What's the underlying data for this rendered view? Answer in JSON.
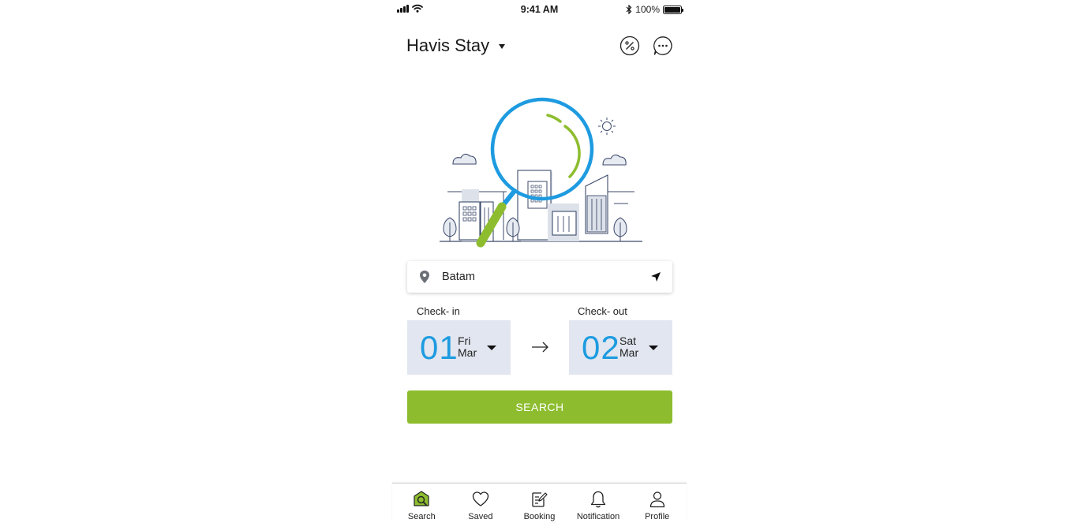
{
  "status_bar": {
    "time": "9:41 AM",
    "battery": "100%"
  },
  "header": {
    "title": "Havis Stay",
    "promo_icon": "percent-icon",
    "chat_icon": "chat-icon"
  },
  "location": {
    "value": "Batam",
    "pin_icon": "location-pin-icon",
    "locate_icon": "navigation-arrow-icon"
  },
  "checkin": {
    "label": "Check- in",
    "day": "01",
    "weekday": "Fri",
    "month": "Mar"
  },
  "checkout": {
    "label": "Check- out",
    "day": "02",
    "weekday": "Sat",
    "month": "Mar"
  },
  "search_button": {
    "label": "SEARCH"
  },
  "colors": {
    "accent_green": "#8dbd2f",
    "accent_blue": "#1e9be0",
    "date_bg": "#e1e6f0"
  },
  "nav": {
    "items": [
      {
        "label": "Search",
        "icon": "search-home-icon",
        "active": true
      },
      {
        "label": "Saved",
        "icon": "heart-icon"
      },
      {
        "label": "Booking",
        "icon": "booking-icon"
      },
      {
        "label": "Notification",
        "icon": "bell-icon"
      },
      {
        "label": "Profile",
        "icon": "user-icon"
      }
    ]
  }
}
